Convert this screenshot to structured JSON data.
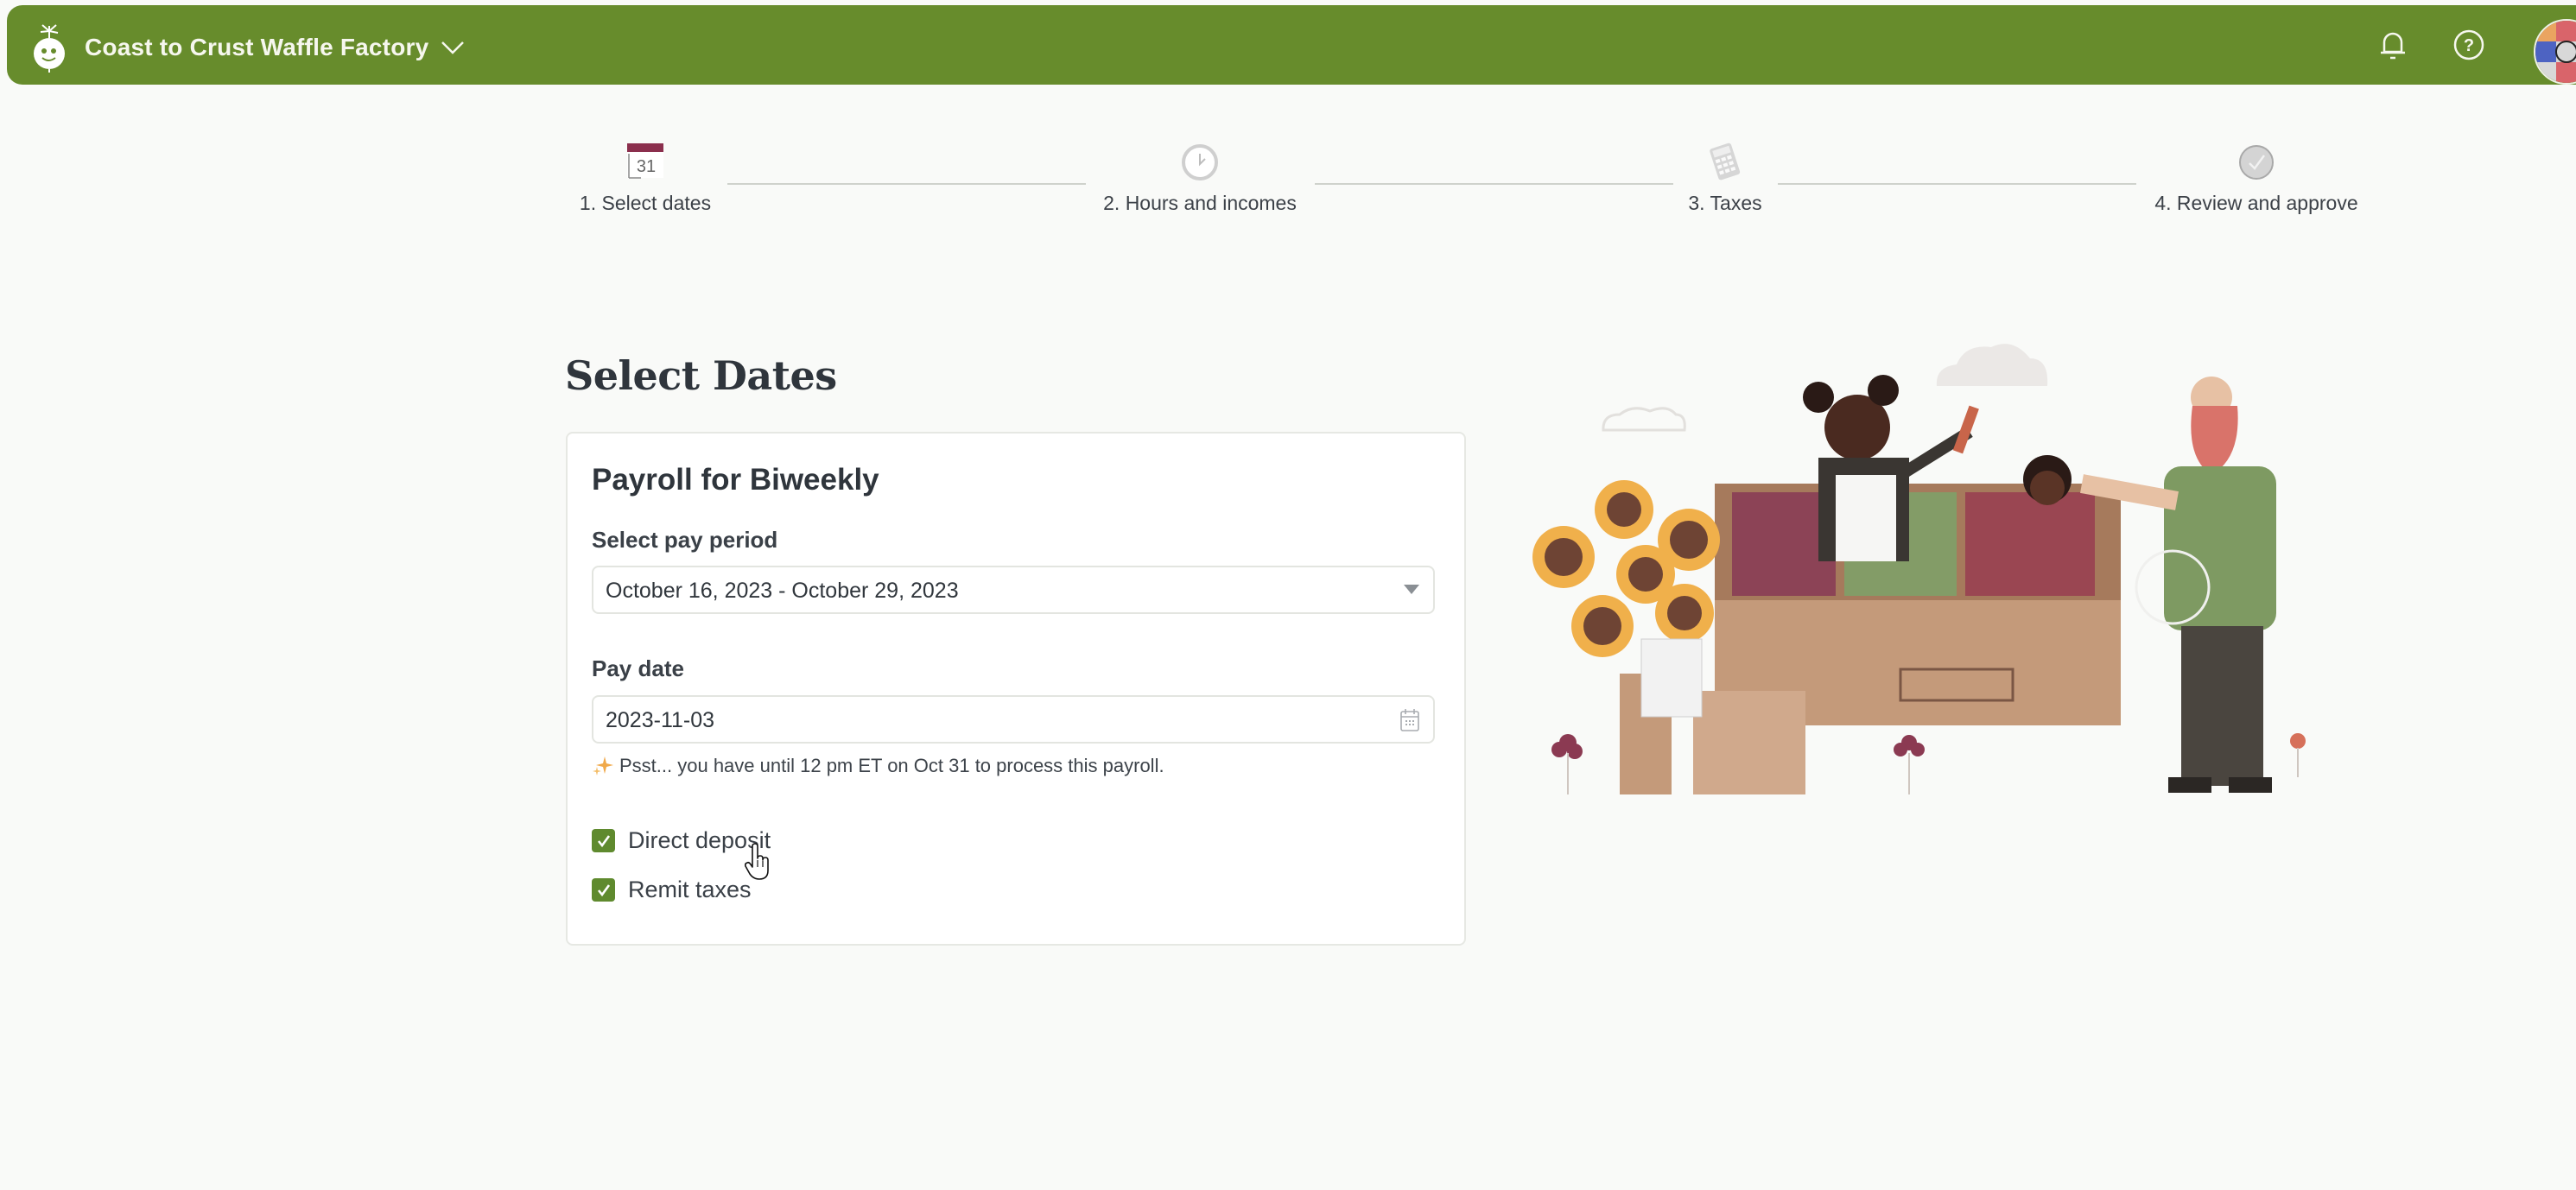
{
  "header": {
    "company_name": "Coast to Crust Waffle Factory",
    "icons": {
      "logo": "company-logo-icon",
      "dropdown": "chevron-down-icon",
      "notifications": "bell-icon",
      "help": "help-circle-icon",
      "avatar": "user-avatar"
    },
    "colors": {
      "bar": "#678c2c",
      "text": "#f6f7ee"
    }
  },
  "stepper": {
    "steps": [
      {
        "label": "1. Select dates",
        "icon": "calendar-icon",
        "state": "active"
      },
      {
        "label": "2. Hours and incomes",
        "icon": "clock-icon",
        "state": "upcoming"
      },
      {
        "label": "3. Taxes",
        "icon": "calculator-icon",
        "state": "upcoming"
      },
      {
        "label": "4. Review and approve",
        "icon": "checkmark-circle-icon",
        "state": "upcoming"
      }
    ]
  },
  "page": {
    "title": "Select Dates"
  },
  "form": {
    "card_title": "Payroll for Biweekly",
    "pay_period": {
      "label": "Select pay period",
      "selected": "October 16, 2023 - October 29, 2023"
    },
    "pay_date": {
      "label": "Pay date",
      "value": "2023-11-03"
    },
    "hint": "Psst... you have until 12 pm ET on Oct 31 to process this payroll.",
    "checkboxes": [
      {
        "label": "Direct deposit",
        "checked": true
      },
      {
        "label": "Remit taxes",
        "checked": true
      }
    ],
    "accent_color": "#5f8a2e"
  },
  "illustration": {
    "description": "farmers-market-stall-illustration"
  }
}
